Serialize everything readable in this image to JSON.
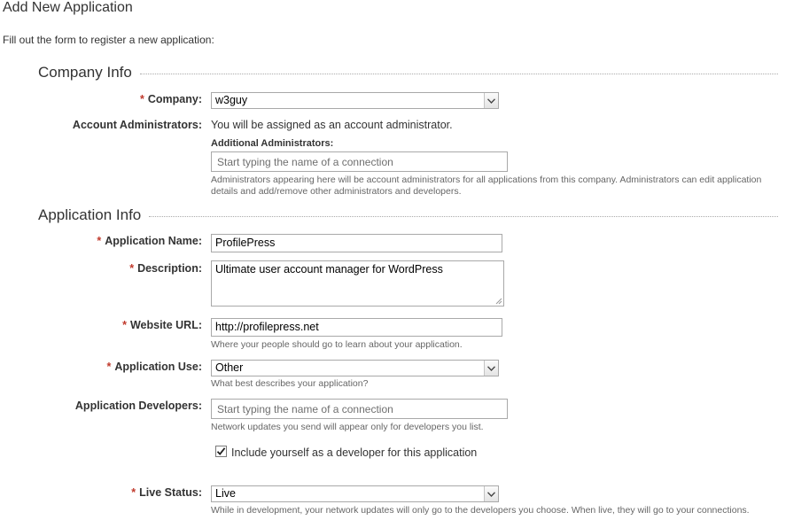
{
  "page": {
    "title": "Add New Application",
    "intro": "Fill out the form to register a new application:"
  },
  "sections": {
    "company_info": "Company Info",
    "application_info": "Application Info"
  },
  "company": {
    "label": "Company:",
    "value": "w3guy"
  },
  "account_admins": {
    "label": "Account Administrators:",
    "text": "You will be assigned as an account administrator.",
    "additional_label": "Additional Administrators:",
    "placeholder": "Start typing the name of a connection",
    "help_line1": "Administrators appearing here will be account administrators for all applications from this company. Administrators can edit application",
    "help_line2": "details and add/remove other administrators and developers."
  },
  "app_name": {
    "label": "Application Name:",
    "value": "ProfilePress"
  },
  "description": {
    "label": "Description:",
    "value": "Ultimate user account manager for WordPress"
  },
  "website": {
    "label": "Website URL:",
    "value": "http://profilepress.net",
    "help": "Where your people should go to learn about your application."
  },
  "app_use": {
    "label": "Application Use:",
    "value": "Other",
    "help": "What best describes your application?"
  },
  "developers": {
    "label": "Application Developers:",
    "placeholder": "Start typing the name of a connection",
    "help": "Network updates you send will appear only for developers you list.",
    "include_self_label": "Include yourself as a developer for this application",
    "include_self_checked": true
  },
  "live_status": {
    "label": "Live Status:",
    "value": "Live",
    "help": "While in development, your network updates will only go to the developers you choose. When live, they will go to your connections."
  },
  "required_marker": "*",
  "icons": {
    "dropdown": "chevron-down-icon",
    "check": "checkmark-icon",
    "resize": "resize-grip-icon"
  },
  "colors": {
    "required": "#c0392b",
    "text": "#333333",
    "help_text": "#666666",
    "field_border": "#a9a9a9"
  }
}
